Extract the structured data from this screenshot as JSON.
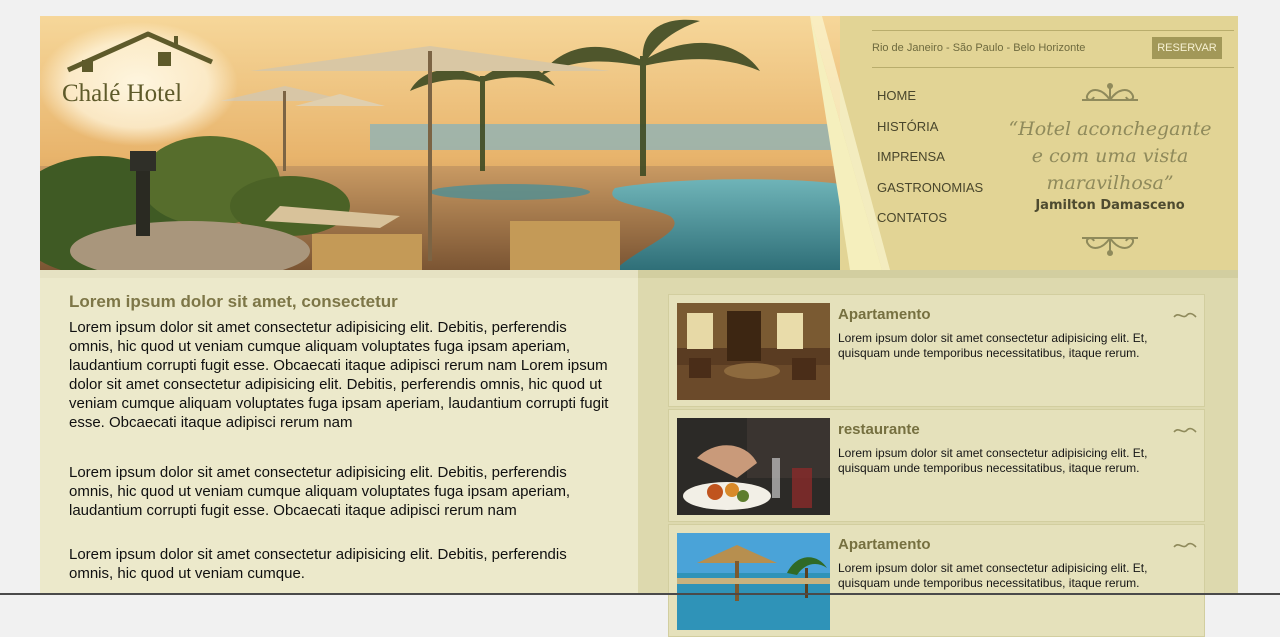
{
  "brand": {
    "name": "Chalé Hotel"
  },
  "header": {
    "cities": "Rio de Janeiro - São Paulo - Belo Horizonte",
    "reserve_label": "RESERVAR",
    "nav": [
      "HOME",
      "HISTÓRIA",
      "IMPRENSA",
      "GASTRONOMIAS",
      "CONTATOS"
    ],
    "quote": {
      "line1": "“Hotel aconchegante",
      "line2": "e com uma vista",
      "line3": "maravilhosa”",
      "author": "Jamilton Damasceno"
    }
  },
  "main": {
    "heading": "Lorem ipsum dolor sit amet, consectetur",
    "paragraphs": [
      "Lorem ipsum dolor sit amet consectetur adipisicing elit. Debitis, perferendis omnis, hic quod ut veniam cumque aliquam voluptates fuga ipsam aperiam, laudantium corrupti fugit esse. Obcaecati itaque adipisci rerum nam Lorem ipsum dolor sit amet consectetur adipisicing elit. Debitis, perferendis omnis, hic quod ut veniam cumque aliquam voluptates fuga ipsam aperiam, laudantium corrupti fugit esse. Obcaecati itaque adipisci rerum nam",
      "Lorem ipsum dolor sit amet consectetur adipisicing elit. Debitis, perferendis omnis, hic quod ut veniam cumque aliquam voluptates fuga ipsam aperiam, laudantium corrupti fugit esse. Obcaecati itaque adipisci rerum nam",
      "Lorem ipsum dolor sit amet consectetur adipisicing elit. Debitis, perferendis omnis, hic quod ut veniam cumque."
    ]
  },
  "sidebar": {
    "cards": [
      {
        "title": "Apartamento",
        "text": "Lorem ipsum dolor sit amet consectetur adipisicing elit. Et, quisquam unde temporibus necessitatibus, itaque rerum."
      },
      {
        "title": "restaurante",
        "text": "Lorem ipsum dolor sit amet consectetur adipisicing elit. Et, quisquam unde temporibus necessitatibus, itaque rerum."
      },
      {
        "title": "Apartamento",
        "text": "Lorem ipsum dolor sit amet consectetur adipisicing elit. Et, quisquam unde temporibus necessitatibus, itaque rerum."
      }
    ]
  },
  "colors": {
    "header_bg": "#e2d495",
    "accent_button": "#a29858",
    "heading": "#7d7647",
    "left_bg": "#ece9cb",
    "right_bg": "#ddd9ae"
  }
}
